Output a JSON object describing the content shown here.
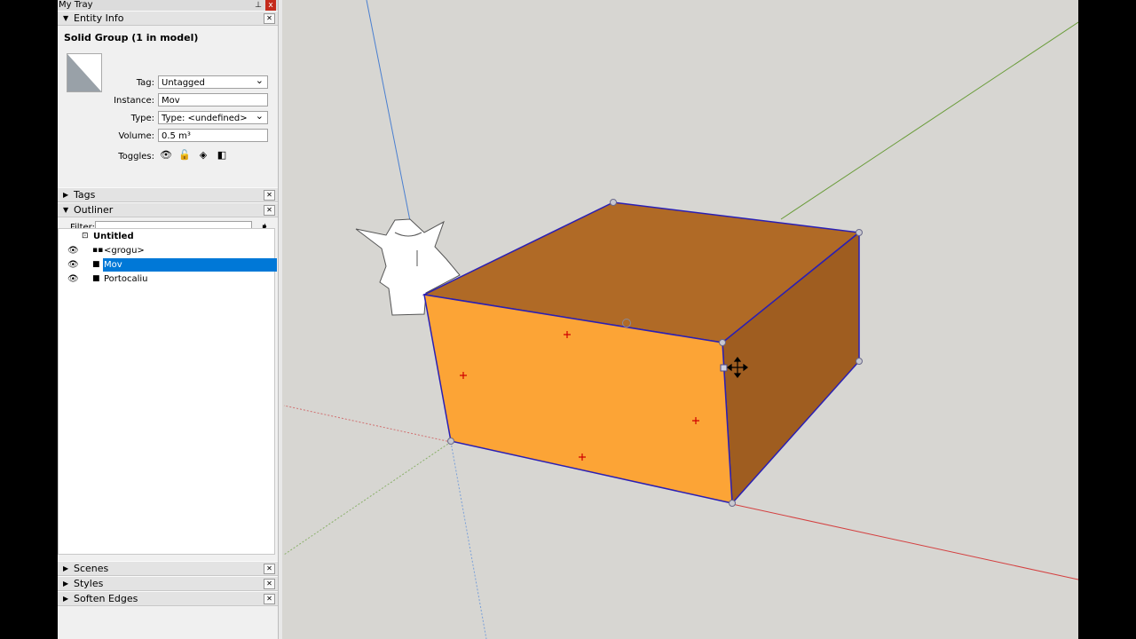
{
  "tray": {
    "title": "My Tray",
    "pin_icon": "pin-icon",
    "close_label": "x"
  },
  "entity_info": {
    "title": "Entity Info",
    "heading": "Solid Group (1 in model)",
    "tag_label": "Tag:",
    "tag_value": "Untagged",
    "instance_label": "Instance:",
    "instance_value": "Mov",
    "type_label": "Type:",
    "type_value": "Type: <undefined>",
    "volume_label": "Volume:",
    "volume_value": "0.5 m³",
    "toggles_label": "Toggles:",
    "toggle_icons": [
      "eye-icon",
      "lock-icon",
      "receive-shadows-icon",
      "cast-shadows-icon"
    ]
  },
  "tags": {
    "title": "Tags"
  },
  "outliner": {
    "title": "Outliner",
    "filter_label": "Filter:",
    "filter_value": "",
    "items": [
      {
        "label": "Untitled",
        "icon": "model-icon",
        "visible": false,
        "selected": false
      },
      {
        "label": "<grogu>",
        "icon": "component-icon",
        "visible": true,
        "selected": false
      },
      {
        "label": "Mov",
        "icon": "group-icon",
        "visible": true,
        "selected": true
      },
      {
        "label": "Portocaliu",
        "icon": "group-icon",
        "visible": true,
        "selected": false
      }
    ]
  },
  "bottom_panels": [
    {
      "title": "Scenes"
    },
    {
      "title": "Styles"
    },
    {
      "title": "Soften Edges"
    }
  ],
  "colors": {
    "face_front": "#fca436",
    "face_top": "#b06a26",
    "face_side": "#9f5d20",
    "edge": "#2a1fb4",
    "selection": "#0078d7",
    "viewport_bg": "#d7d6d2"
  }
}
